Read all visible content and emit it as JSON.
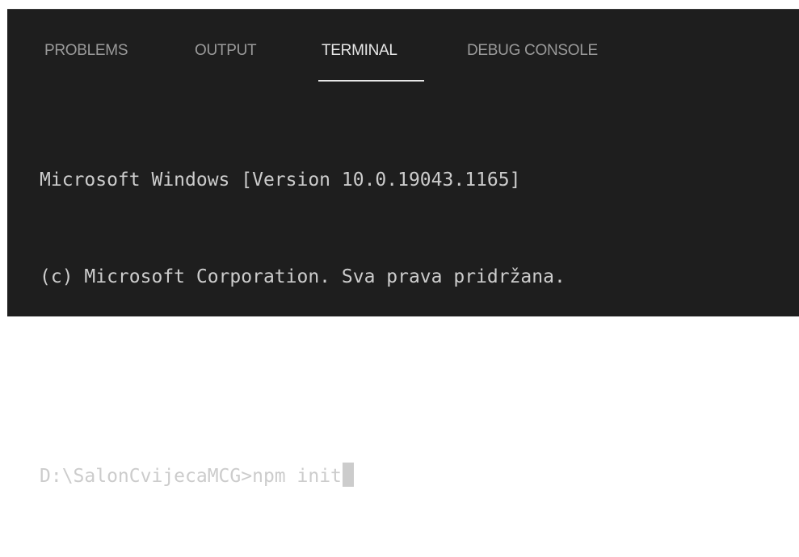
{
  "panel": {
    "tabs": [
      {
        "label": "PROBLEMS",
        "active": false
      },
      {
        "label": "OUTPUT",
        "active": false
      },
      {
        "label": "TERMINAL",
        "active": true
      },
      {
        "label": "DEBUG CONSOLE",
        "active": false
      }
    ]
  },
  "terminal": {
    "lines": [
      "Microsoft Windows [Version 10.0.19043.1165]",
      "(c) Microsoft Corporation. Sva prava pridržana.",
      ""
    ],
    "prompt": "D:\\SalonCvijecaMCG>",
    "command": "npm init"
  },
  "colors": {
    "background": "#1e1e1e",
    "text": "#cccccc",
    "tab_inactive": "#9a9a9a",
    "tab_active": "#e7e7e7"
  }
}
